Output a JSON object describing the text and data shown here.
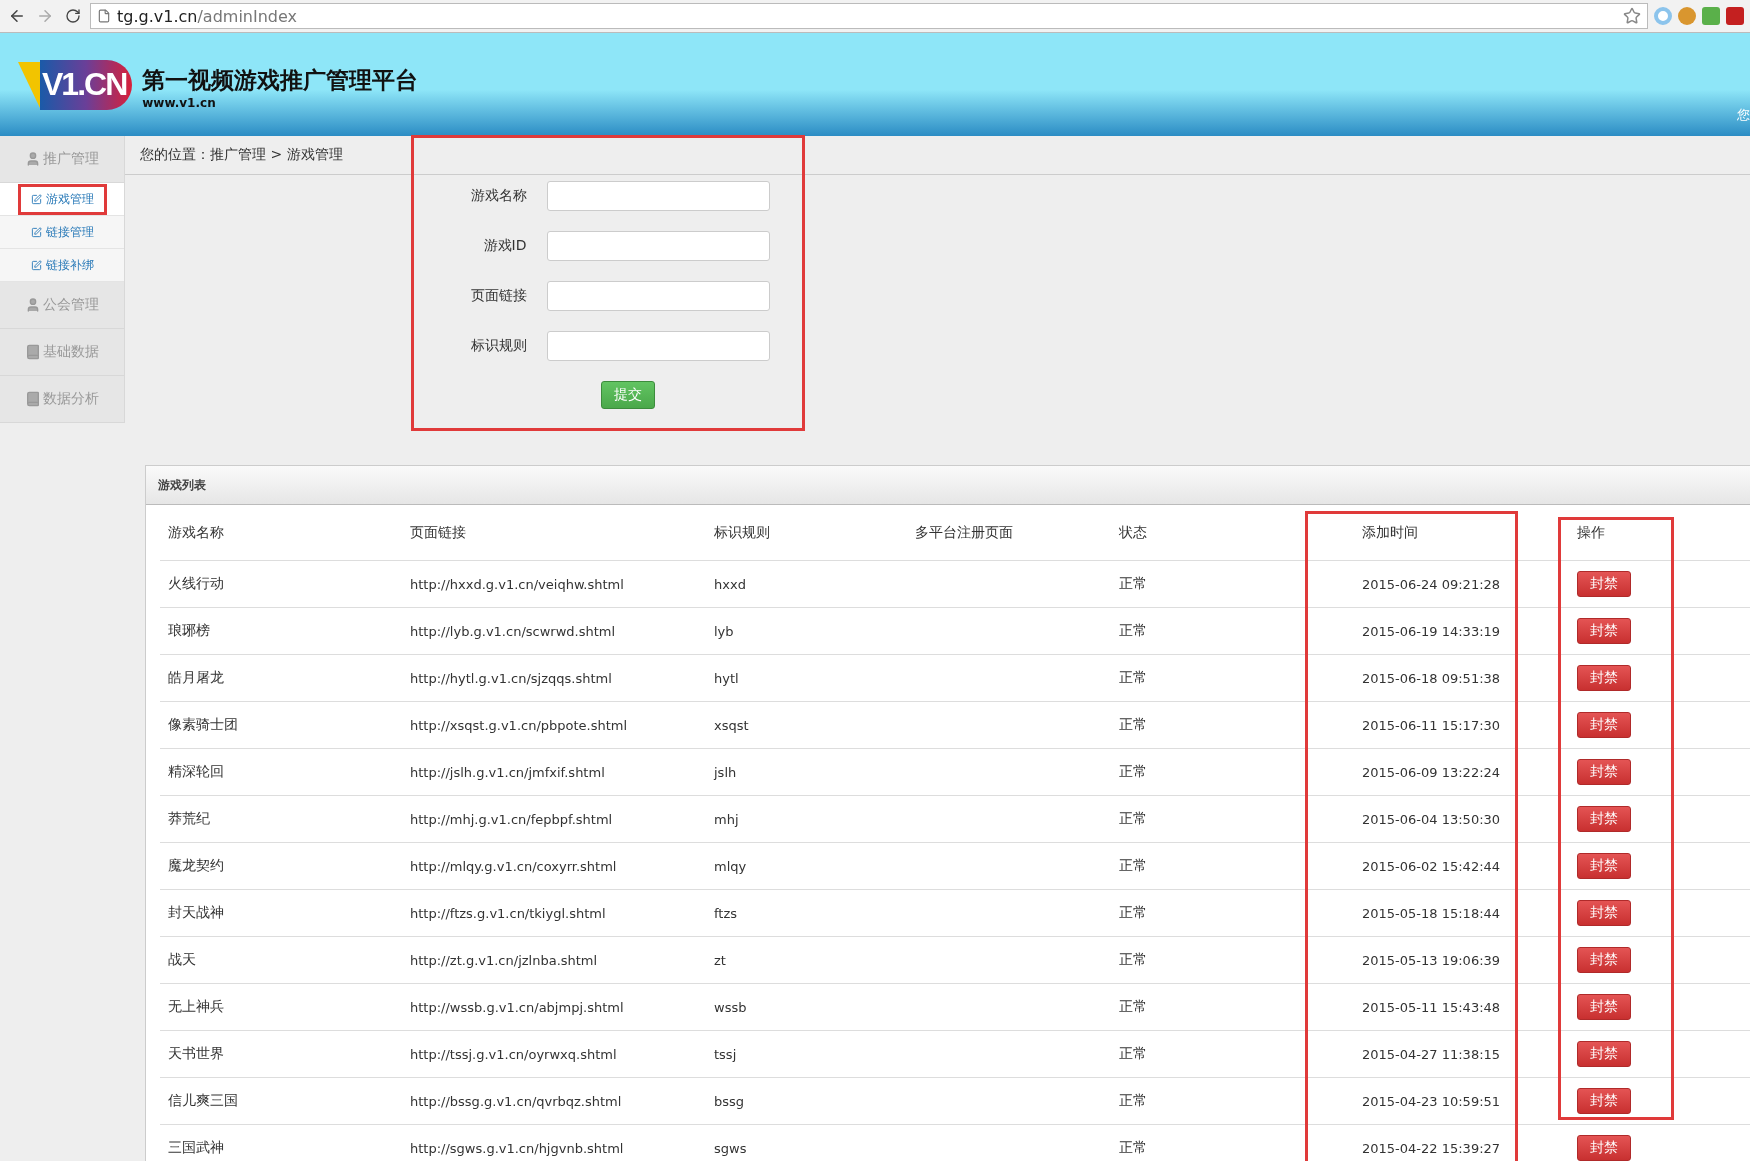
{
  "browser": {
    "url_host": "tg.g.v1.cn",
    "url_path": "/adminIndex"
  },
  "header": {
    "logo": "V1.CN",
    "title": "第一视频游戏推广管理平台",
    "subtitle": "www.v1.cn",
    "user_text": "您"
  },
  "sidebar": [
    {
      "label": "推广管理",
      "children": [
        {
          "label": "游戏管理",
          "selected": true
        },
        {
          "label": "链接管理",
          "selected": false
        },
        {
          "label": "链接补绑",
          "selected": false
        }
      ]
    },
    {
      "label": "公会管理"
    },
    {
      "label": "基础数据"
    },
    {
      "label": "数据分析"
    }
  ],
  "breadcrumb": "您的位置：推广管理 > 游戏管理",
  "form": {
    "highlighted": true,
    "fields": [
      {
        "label": "游戏名称"
      },
      {
        "label": "游戏ID"
      },
      {
        "label": "页面链接"
      },
      {
        "label": "标识规则"
      }
    ],
    "submit": "提交"
  },
  "table": {
    "title": "游戏列表",
    "columns": [
      {
        "label": "游戏名称",
        "highlighted": false
      },
      {
        "label": "页面链接",
        "highlighted": false
      },
      {
        "label": "标识规则",
        "highlighted": false
      },
      {
        "label": "多平台注册页面",
        "highlighted": false
      },
      {
        "label": "状态",
        "highlighted": false
      },
      {
        "label": "添加时间",
        "highlighted": true
      },
      {
        "label": "操作",
        "highlighted": true
      }
    ],
    "rows": [
      {
        "name": "火线行动",
        "url": "http://hxxd.g.v1.cn/veiqhw.shtml",
        "rule": "hxxd",
        "status": "正常",
        "time": "2015-06-24 09:21:28",
        "action": "封禁"
      },
      {
        "name": "琅琊榜",
        "url": "http://lyb.g.v1.cn/scwrwd.shtml",
        "rule": "lyb",
        "status": "正常",
        "time": "2015-06-19 14:33:19",
        "action": "封禁"
      },
      {
        "name": "皓月屠龙",
        "url": "http://hytl.g.v1.cn/sjzqqs.shtml",
        "rule": "hytl",
        "status": "正常",
        "time": "2015-06-18 09:51:38",
        "action": "封禁"
      },
      {
        "name": "像素骑士团",
        "url": "http://xsqst.g.v1.cn/pbpote.shtml",
        "rule": "xsqst",
        "status": "正常",
        "time": "2015-06-11 15:17:30",
        "action": "封禁"
      },
      {
        "name": "精深轮回",
        "url": "http://jslh.g.v1.cn/jmfxif.shtml",
        "rule": "jslh",
        "status": "正常",
        "time": "2015-06-09 13:22:24",
        "action": "封禁"
      },
      {
        "name": "莽荒纪",
        "url": "http://mhj.g.v1.cn/fepbpf.shtml",
        "rule": "mhj",
        "status": "正常",
        "time": "2015-06-04 13:50:30",
        "action": "封禁"
      },
      {
        "name": "魔龙契约",
        "url": "http://mlqy.g.v1.cn/coxyrr.shtml",
        "rule": "mlqy",
        "status": "正常",
        "time": "2015-06-02 15:42:44",
        "action": "封禁"
      },
      {
        "name": "封天战神",
        "url": "http://ftzs.g.v1.cn/tkiygl.shtml",
        "rule": "ftzs",
        "status": "正常",
        "time": "2015-05-18 15:18:44",
        "action": "封禁"
      },
      {
        "name": "战天",
        "url": "http://zt.g.v1.cn/jzlnba.shtml",
        "rule": "zt",
        "status": "正常",
        "time": "2015-05-13 19:06:39",
        "action": "封禁"
      },
      {
        "name": "无上神兵",
        "url": "http://wssb.g.v1.cn/abjmpj.shtml",
        "rule": "wssb",
        "status": "正常",
        "time": "2015-05-11 15:43:48",
        "action": "封禁"
      },
      {
        "name": "天书世界",
        "url": "http://tssj.g.v1.cn/oyrwxq.shtml",
        "rule": "tssj",
        "status": "正常",
        "time": "2015-04-27 11:38:15",
        "action": "封禁"
      },
      {
        "name": "信儿爽三国",
        "url": "http://bssg.g.v1.cn/qvrbqz.shtml",
        "rule": "bssg",
        "status": "正常",
        "time": "2015-04-23 10:59:51",
        "action": "封禁"
      },
      {
        "name": "三国武神",
        "url": "http://sgws.g.v1.cn/hjgvnb.shtml",
        "rule": "sgws",
        "status": "正常",
        "time": "2015-04-22 15:39:27",
        "action": "封禁"
      }
    ]
  }
}
